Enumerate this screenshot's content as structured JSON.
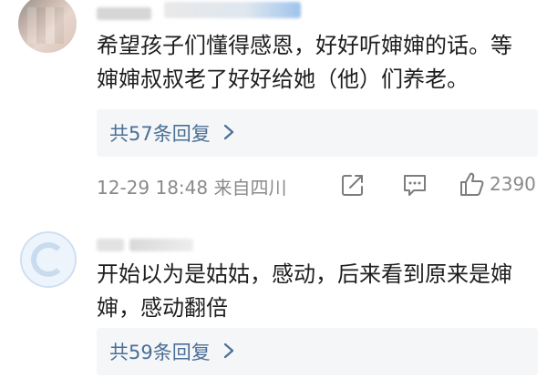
{
  "comments": [
    {
      "text_line1": "希望孩子们懂得感恩，好好听婶婶的话。等",
      "text_line2": "婶婶叔叔老了好好给她（他）们养老。",
      "replies_label": "共57条回复",
      "timestamp": "12-29 18:48",
      "location": "来自四川",
      "like_count": "2390"
    },
    {
      "text_line1": "开始以为是姑姑，感动，后来看到原来是婶",
      "text_line2": "婶，感动翻倍",
      "replies_label": "共59条回复"
    }
  ],
  "colors": {
    "link": "#4a6f97",
    "meta": "#8a8a8a",
    "reply_bg": "#f5f6f8"
  },
  "icons": [
    "share-icon",
    "comment-icon",
    "like-icon",
    "chevron-right-icon"
  ]
}
